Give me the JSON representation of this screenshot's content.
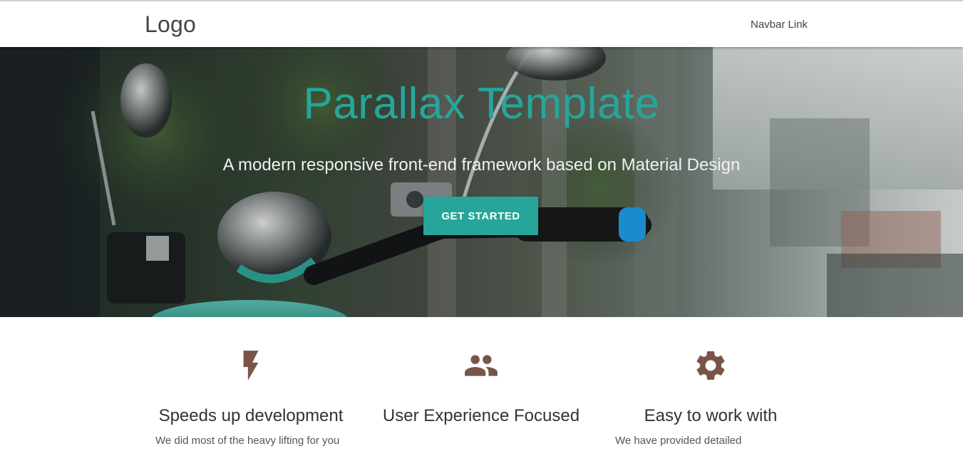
{
  "navbar": {
    "logo": "Logo",
    "link": "Navbar Link"
  },
  "hero": {
    "title": "Parallax Template",
    "subtitle": "A modern responsive front-end framework based on Material Design",
    "cta_label": "GET STARTED",
    "accent_color": "#26a69a"
  },
  "features": [
    {
      "icon": "flash-icon",
      "title": "Speeds up development",
      "text": "We did most of the heavy lifting for you"
    },
    {
      "icon": "group-icon",
      "title": "User Experience Focused",
      "text": ""
    },
    {
      "icon": "settings-icon",
      "title": "Easy to work with",
      "text": "We have provided detailed"
    }
  ],
  "colors": {
    "icon_brown": "#795548",
    "teal": "#26a69a"
  }
}
